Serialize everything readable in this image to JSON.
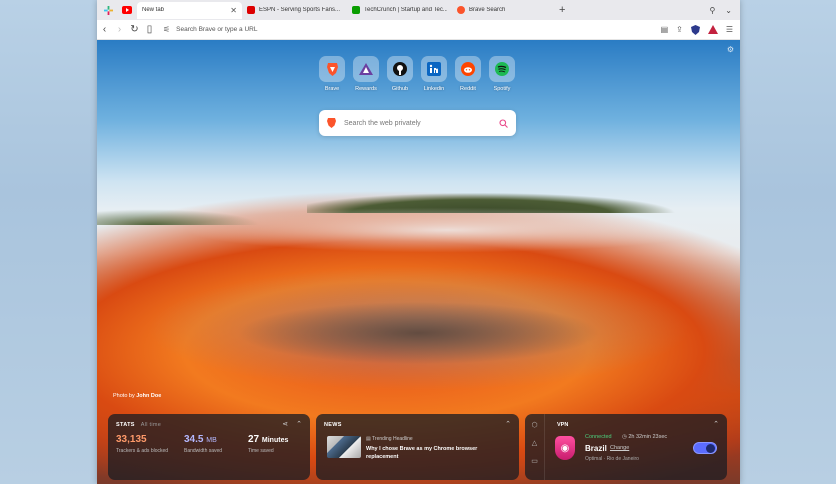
{
  "tabs": [
    {
      "title": "New tab",
      "active": true,
      "favicon_color": "#ffffff"
    },
    {
      "title": "ESPN - Serving Sports Fans...",
      "active": false,
      "favicon_color": "#d00"
    },
    {
      "title": "TechCrunch | Startup and Tec...",
      "active": false,
      "favicon_color": "#0a9e01"
    },
    {
      "title": "Brave Search",
      "active": false,
      "favicon_color": "#fb542b"
    }
  ],
  "toolbar": {
    "url_placeholder": "Search Brave or type a URL"
  },
  "top_sites": [
    {
      "label": "Brave",
      "icon": "brave-lion-icon",
      "color": "#fb542b"
    },
    {
      "label": "Rewards",
      "icon": "rewards-triangle-icon",
      "color": "#6b3fa0"
    },
    {
      "label": "Github",
      "icon": "github-icon",
      "color": "#111111"
    },
    {
      "label": "Linkedin",
      "icon": "linkedin-icon",
      "color": "#0a66c2"
    },
    {
      "label": "Reddit",
      "icon": "reddit-icon",
      "color": "#ff4500"
    },
    {
      "label": "Spotify",
      "icon": "spotify-icon",
      "color": "#1db954"
    }
  ],
  "search": {
    "placeholder": "Search the web privately"
  },
  "photo_credit": {
    "prefix": "Photo by",
    "author": "John Doe"
  },
  "stats": {
    "title": "STATS",
    "range": "All time",
    "trackers": {
      "value": "33,135",
      "caption": "Trackers & ads blocked",
      "color": "#ff9a6a"
    },
    "bandwidth": {
      "value": "34.5",
      "unit": "MB",
      "caption": "Bandwidth saved",
      "color": "#b5b9ff"
    },
    "time": {
      "value": "27",
      "unit": "Minutes",
      "caption": "Time saved"
    }
  },
  "news": {
    "title": "NEWS",
    "tag": "Trending Headline",
    "headline": "Why I chose Brave as my Chrome browser replacement"
  },
  "vpn": {
    "title": "VPN",
    "status": "Connected",
    "duration": "2h 32min 23sec",
    "country": "Brazil",
    "change_label": "Change",
    "server": "Optimal · Rio de Janeiro",
    "enabled": true
  }
}
